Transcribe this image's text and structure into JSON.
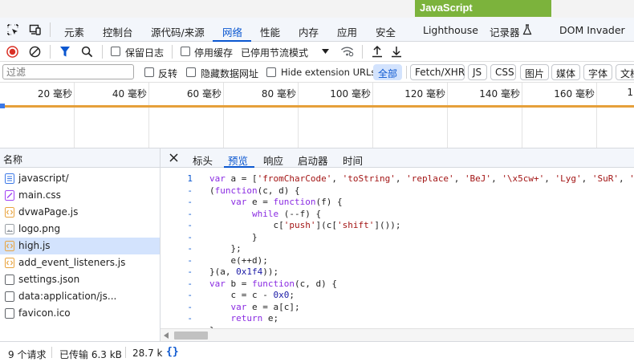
{
  "banner": {
    "text": "JavaScript",
    "color": "#7cb33c"
  },
  "tabs": {
    "items": [
      {
        "label": "元素"
      },
      {
        "label": "控制台"
      },
      {
        "label": "源代码/来源"
      },
      {
        "label": "网络"
      },
      {
        "label": "性能"
      },
      {
        "label": "内存"
      },
      {
        "label": "应用"
      },
      {
        "label": "安全"
      },
      {
        "label": "Lighthouse"
      },
      {
        "label": "记录器"
      },
      {
        "label": "DOM Invader"
      }
    ],
    "active": "网络"
  },
  "toolbar": {
    "preserve_log": "保留日志",
    "disable_cache": "停用缓存",
    "throttling": "已停用节流模式"
  },
  "filter": {
    "placeholder": "过滤",
    "invert": "反转",
    "hide_data_urls": "隐藏数据网址",
    "hide_ext_urls": "Hide extension URLs",
    "types": [
      "全部",
      "Fetch/XHR",
      "JS",
      "CSS",
      "图片",
      "媒体",
      "字体",
      "文档"
    ]
  },
  "timeline": {
    "ticks": [
      "20 毫秒",
      "40 毫秒",
      "60 毫秒",
      "80 毫秒",
      "100 毫秒",
      "120 毫秒",
      "140 毫秒",
      "160 毫秒",
      "1"
    ]
  },
  "requests": {
    "header": "名称",
    "files": [
      {
        "name": "javascript/",
        "icon": "document-icon",
        "color": "#3b78e7"
      },
      {
        "name": "main.css",
        "icon": "css-file-icon",
        "color": "#a142f4"
      },
      {
        "name": "dvwaPage.js",
        "icon": "js-file-icon",
        "color": "#e8a33d"
      },
      {
        "name": "logo.png",
        "icon": "image-file-icon",
        "color": "#9aa0a6"
      },
      {
        "name": "high.js",
        "icon": "js-file-icon",
        "color": "#e8a33d"
      },
      {
        "name": "add_event_listeners.js",
        "icon": "js-file-icon",
        "color": "#e8a33d"
      },
      {
        "name": "settings.json",
        "icon": "generic-file-icon",
        "color": "#5f6368"
      },
      {
        "name": "data:application/js...",
        "icon": "generic-file-icon",
        "color": "#5f6368"
      },
      {
        "name": "favicon.ico",
        "icon": "generic-file-icon",
        "color": "#5f6368"
      }
    ],
    "selected": "high.js"
  },
  "detail": {
    "tabs": [
      "标头",
      "预览",
      "响应",
      "启动器",
      "时间"
    ],
    "active": "预览",
    "gutter": [
      "1",
      "-",
      "-",
      "-",
      "-",
      "-",
      "-",
      "-",
      "-",
      "-",
      "-",
      "-",
      "-",
      "-"
    ],
    "code": [
      "var a = ['fromCharCode', 'toString', 'replace', 'BeJ', '\\x5cw+', 'Lyg', 'SuR', '",
      "(function(c, d) {",
      "    var e = function(f) {",
      "        while (--f) {",
      "            c['push'](c['shift']());",
      "        }",
      "    };",
      "    e(++d);",
      "}(a, 0x1f4));",
      "var b = function(c, d) {",
      "    c = c - 0x0;",
      "    var e = a[c];",
      "    return e;",
      "};"
    ]
  },
  "status": {
    "requests": "9 个请求",
    "transferred": "已传输 6.3 kB",
    "resources": "28.7 k",
    "pretty_print": "{}"
  }
}
